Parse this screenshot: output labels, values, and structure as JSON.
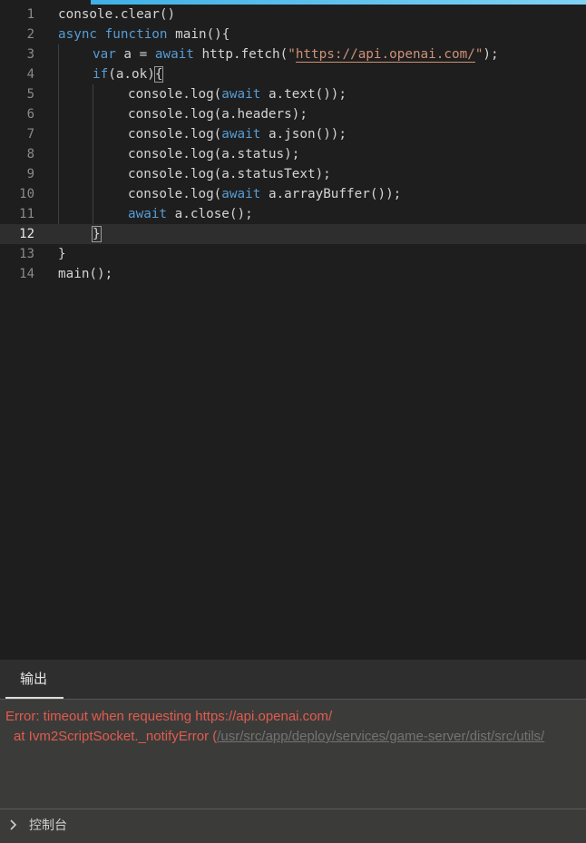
{
  "editor": {
    "lines": [
      {
        "n": "1",
        "text": "console.clear()"
      },
      {
        "n": "2",
        "kw1": "async",
        "kw2": "function",
        "text": " main(){"
      },
      {
        "n": "3",
        "kw1": "var",
        "a": " a = ",
        "kw2": "await",
        "b": " http.fetch(",
        "q1": "\"",
        "url": "https://api.openai.com/",
        "q2": "\"",
        "c": ");"
      },
      {
        "n": "4",
        "kw1": "if",
        "text": "(a.ok)",
        "brace": "{"
      },
      {
        "n": "5",
        "pre": "console.log(",
        "kw": "await",
        "post": " a.text());"
      },
      {
        "n": "6",
        "text": "console.log(a.headers);"
      },
      {
        "n": "7",
        "pre": "console.log(",
        "kw": "await",
        "post": " a.json());"
      },
      {
        "n": "8",
        "text": "console.log(a.status);"
      },
      {
        "n": "9",
        "text": "console.log(a.statusText);"
      },
      {
        "n": "10",
        "pre": "console.log(",
        "kw": "await",
        "post": " a.arrayBuffer());"
      },
      {
        "n": "11",
        "kw": "await",
        "post": " a.close();"
      },
      {
        "n": "12",
        "brace": "}"
      },
      {
        "n": "13",
        "text": "}"
      },
      {
        "n": "14",
        "text": "main();"
      }
    ]
  },
  "output": {
    "tab_label": "输出",
    "error_line1": "Error: timeout when requesting https://api.openai.com/",
    "error_line2_prefix": "at Ivm2ScriptSocket._notifyError  (",
    "error_line2_path": "/usr/src/app/deploy/services/game-server/dist/src/utils/"
  },
  "console": {
    "label": "控制台",
    "icon": "chevron-right-icon"
  },
  "colors": {
    "background": "#1e1e1e",
    "keyword": "#569cd6",
    "string": "#ce9178",
    "error": "#e25b4f"
  }
}
